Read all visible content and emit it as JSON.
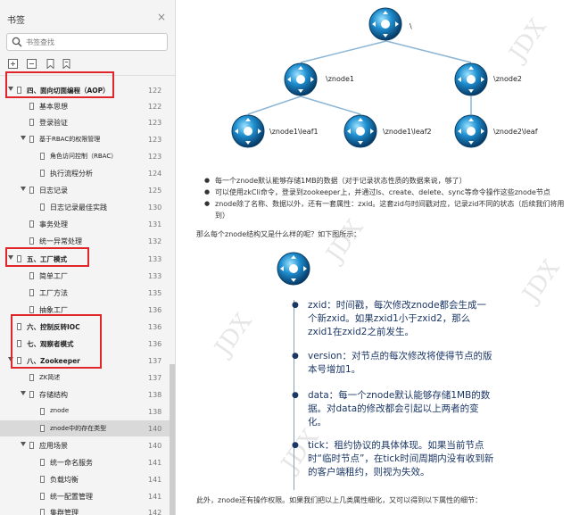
{
  "sidebar": {
    "title": "书签",
    "close_label": "×",
    "search_placeholder": "书签查找",
    "items": [
      {
        "label": "四、面向切面编程（AOP）",
        "page": "122"
      },
      {
        "label": "基本思想",
        "page": "122"
      },
      {
        "label": "登录验证",
        "page": "123"
      },
      {
        "label": "基于RBAC的权限管理",
        "page": "123"
      },
      {
        "label": "角色访问控制（RBAC）",
        "page": "123"
      },
      {
        "label": "执行流程分析",
        "page": "124"
      },
      {
        "label": "日志记录",
        "page": "125"
      },
      {
        "label": "日志记录最佳实践",
        "page": "130"
      },
      {
        "label": "事务处理",
        "page": "131"
      },
      {
        "label": "统一异常处理",
        "page": "132"
      },
      {
        "label": "五、工厂模式",
        "page": "133"
      },
      {
        "label": "简单工厂",
        "page": "133"
      },
      {
        "label": "工厂方法",
        "page": "135"
      },
      {
        "label": "抽象工厂",
        "page": "136"
      },
      {
        "label": "六、控制反转IOC",
        "page": "136"
      },
      {
        "label": "七、观察者模式",
        "page": "136"
      },
      {
        "label": "八、Zookeeper",
        "page": "137"
      },
      {
        "label": "ZK简述",
        "page": "137"
      },
      {
        "label": "存储结构",
        "page": "138"
      },
      {
        "label": "znode",
        "page": "138"
      },
      {
        "label": "znode中的存在类型",
        "page": "140"
      },
      {
        "label": "应用场景",
        "page": "140"
      },
      {
        "label": "统一命名服务",
        "page": "141"
      },
      {
        "label": "负载均衡",
        "page": "141"
      },
      {
        "label": "统一配置管理",
        "page": "141"
      },
      {
        "label": "集群管理",
        "page": "142"
      }
    ]
  },
  "doc": {
    "watermark": "JDX",
    "tree": {
      "root": "\\",
      "nodes": [
        "\\znode1",
        "\\znode2"
      ],
      "leaves": [
        "\\znode1\\leaf1",
        "\\znode1\\leaf2",
        "\\znode2\\leaf"
      ]
    },
    "bullets": [
      "每一个znode默认能够存储1MB的数据（对于记录状态性质的数据来说，够了）",
      "可以使用zkCli命令，登录到zookeeper上，并通过ls、create、delete、sync等命令操作这些znode节点",
      "znode除了名称、数据以外，还有一套属性：zxid。这套zid与时间戳对应，记录zid不同的状态（后续我们将用到）"
    ],
    "question": "那么每个znode结构又是什么样的呢？如下图所示：",
    "props": [
      "zxid：时间戳，每次修改znode都会生成一个新zxid。如果zxid1小于zxid2，那么zxid1在zxid2之前发生。",
      "version：对节点的每次修改将使得节点的版本号增加1。",
      "data：每一个znode默认能够存储1MB的数据。对data的修改都会引起以上两者的变化。",
      "tick：租约协议的具体体现。如果当前节点时“临时节点”，在tick时间周期内没有收到新的客户端租约，则视为失效。"
    ],
    "last_line": "此外，znode还有操作权限。如果我们把以上几类属性细化，又可以得到以下属性的细节："
  }
}
